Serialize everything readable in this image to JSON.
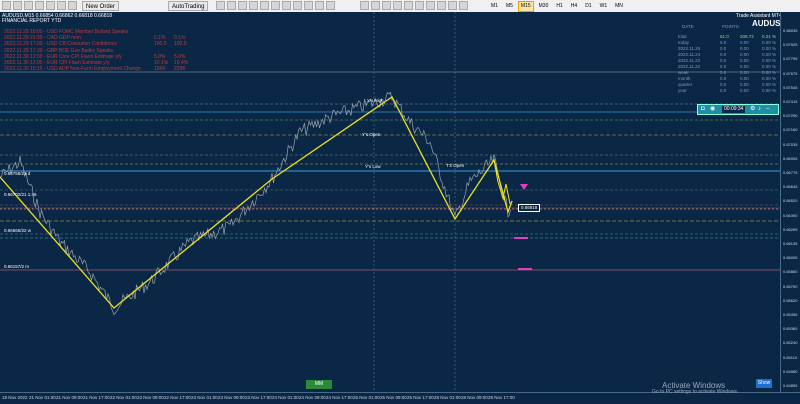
{
  "toolbar": {
    "new_order_label": "New Order",
    "autotrading_label": "AutoTrading",
    "timeframes": [
      "M1",
      "M5",
      "M15",
      "M30",
      "H1",
      "H4",
      "D1",
      "W1",
      "MN"
    ],
    "active_timeframe": "M15"
  },
  "chart_header": {
    "symbol_line": "AUDUSD,M15  0.66854 0.66862 0.66818 0.66818",
    "subtitle": "FINANCIAL REPORT YTD"
  },
  "news": [
    {
      "text": "2022.11.29 18:00 - USD FOMC Member Bullard Speaks",
      "v1": "",
      "v2": ""
    },
    {
      "text": "2022.11.29 21:30 - CAD GDP m/m",
      "v1": "0.1%",
      "v2": "0.1%"
    },
    {
      "text": "2022.11.29 17:00 - USD CB Consumer Confidence",
      "v1": "100.5",
      "v2": "100.9"
    },
    {
      "text": "2022.11.29 17:30 - GBP BOE Gov Bailey Speaks",
      "v1": "",
      "v2": ""
    },
    {
      "text": "2022.11.30 12:00 - EUR Core CPI Flash Estimate y/y",
      "v1": "5.0%",
      "v2": "5.0%"
    },
    {
      "text": "2022.11.30 12:00 - EUR CPI Flash Estimate y/y",
      "v1": "10.1%",
      "v2": "10.4%"
    },
    {
      "text": "2022.11.30 15:15 - USD ADP Non-Farm Employment Change",
      "v1": "196K",
      "v2": "239K"
    }
  ],
  "panel": {
    "title": "Trade Assistant MT4",
    "pair": "AUDUSD",
    "headers": [
      "DATE",
      "POINTS",
      ""
    ],
    "rows": [
      {
        "label": "total",
        "a": "61.0",
        "b": "209.72",
        "c": "0.21 %"
      },
      {
        "label": "today",
        "a": "0.0",
        "b": "0.00",
        "c": "0.00 %"
      },
      {
        "label": "2022.11.25",
        "a": "0.0",
        "b": "0.00",
        "c": "0.00 %"
      },
      {
        "label": "2022.11.24",
        "a": "0.0",
        "b": "0.00",
        "c": "0.00 %"
      },
      {
        "label": "2022.11.23",
        "a": "0.0",
        "b": "0.00",
        "c": "0.00 %"
      },
      {
        "label": "2022.11.22",
        "a": "0.0",
        "b": "0.00",
        "c": "0.00 %"
      },
      {
        "label": "week",
        "a": "0.0",
        "b": "0.00",
        "c": "0.00 %"
      },
      {
        "label": "month",
        "a": "0.0",
        "b": "0.00",
        "c": "0.00 %"
      },
      {
        "label": "quarter",
        "a": "0.0",
        "b": "0.00",
        "c": "0.00 %"
      },
      {
        "label": "year",
        "a": "0.0",
        "b": "0.00",
        "c": "0.00 %"
      }
    ],
    "mini_time": "00:09:34"
  },
  "levels": {
    "yhigh": "Y's High",
    "yopen": "Y's Open",
    "ylow": "Y's Low",
    "tvalue": "T's Open"
  },
  "price_axis": [
    "0.68035",
    "0.67925",
    "0.67795",
    "0.67675",
    "0.67545",
    "0.67415",
    "0.67290",
    "0.67160",
    "0.67035",
    "0.66905",
    "0.66775",
    "0.66645",
    "0.66520",
    "0.66390",
    "0.66265",
    "0.66135",
    "0.66005",
    "0.65880",
    "0.65750",
    "0.65620",
    "0.65495",
    "0.65365",
    "0.65240",
    "0.65110",
    "0.64980",
    "0.64855"
  ],
  "current_price": "0.66818",
  "time_axis": [
    "18 Nov 2022",
    "21 Nov 01:00",
    "21 Nov 09:00",
    "21 Nov 17:00",
    "22 Nov 01:00",
    "22 Nov 09:00",
    "22 Nov 17:00",
    "23 Nov 01:00",
    "23 Nov 09:00",
    "23 Nov 17:00",
    "24 Nov 01:00",
    "24 Nov 09:00",
    "24 Nov 17:00",
    "25 Nov 01:00",
    "25 Nov 09:00",
    "25 Nov 17:00",
    "28 Nov 01:00",
    "28 Nov 09:00",
    "28 Nov 17:00"
  ],
  "left_labels": [
    "0.66756/21 d",
    "0.66702/21 1:46",
    "0.66565/22 w",
    "0.66157/2 m"
  ],
  "buttons": {
    "mm": "MM",
    "show": "Show"
  },
  "watermark": {
    "line1": "Activate Windows",
    "line2": "Go to PC settings to activate Windows."
  }
}
